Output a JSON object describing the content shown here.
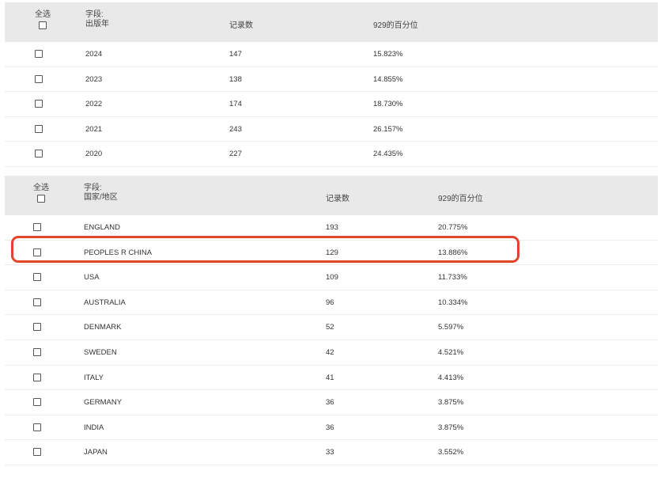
{
  "table1": {
    "select_all_label": "全选",
    "field_label": "字段:",
    "field_name": "出版年",
    "count_header": "记录数",
    "pct_header": "929的百分位",
    "rows": [
      {
        "value": "2024",
        "count": "147",
        "pct": "15.823%"
      },
      {
        "value": "2023",
        "count": "138",
        "pct": "14.855%"
      },
      {
        "value": "2022",
        "count": "174",
        "pct": "18.730%"
      },
      {
        "value": "2021",
        "count": "243",
        "pct": "26.157%"
      },
      {
        "value": "2020",
        "count": "227",
        "pct": "24.435%"
      }
    ]
  },
  "table2": {
    "select_all_label": "全选",
    "field_label": "字段:",
    "field_name": "国家/地区",
    "count_header": "记录数",
    "pct_header": "929的百分位",
    "rows": [
      {
        "value": "ENGLAND",
        "count": "193",
        "pct": "20.775%"
      },
      {
        "value": "PEOPLES R CHINA",
        "count": "129",
        "pct": "13.886%"
      },
      {
        "value": "USA",
        "count": "109",
        "pct": "11.733%"
      },
      {
        "value": "AUSTRALIA",
        "count": "96",
        "pct": "10.334%"
      },
      {
        "value": "DENMARK",
        "count": "52",
        "pct": "5.597%"
      },
      {
        "value": "SWEDEN",
        "count": "42",
        "pct": "4.521%"
      },
      {
        "value": "ITALY",
        "count": "41",
        "pct": "4.413%"
      },
      {
        "value": "GERMANY",
        "count": "36",
        "pct": "3.875%"
      },
      {
        "value": "INDIA",
        "count": "36",
        "pct": "3.875%"
      },
      {
        "value": "JAPAN",
        "count": "33",
        "pct": "3.552%"
      }
    ],
    "highlighted_row": "PEOPLES R CHINA"
  },
  "colors": {
    "header_bg": "#e9e9e9",
    "highlight_border": "#e4432e"
  }
}
